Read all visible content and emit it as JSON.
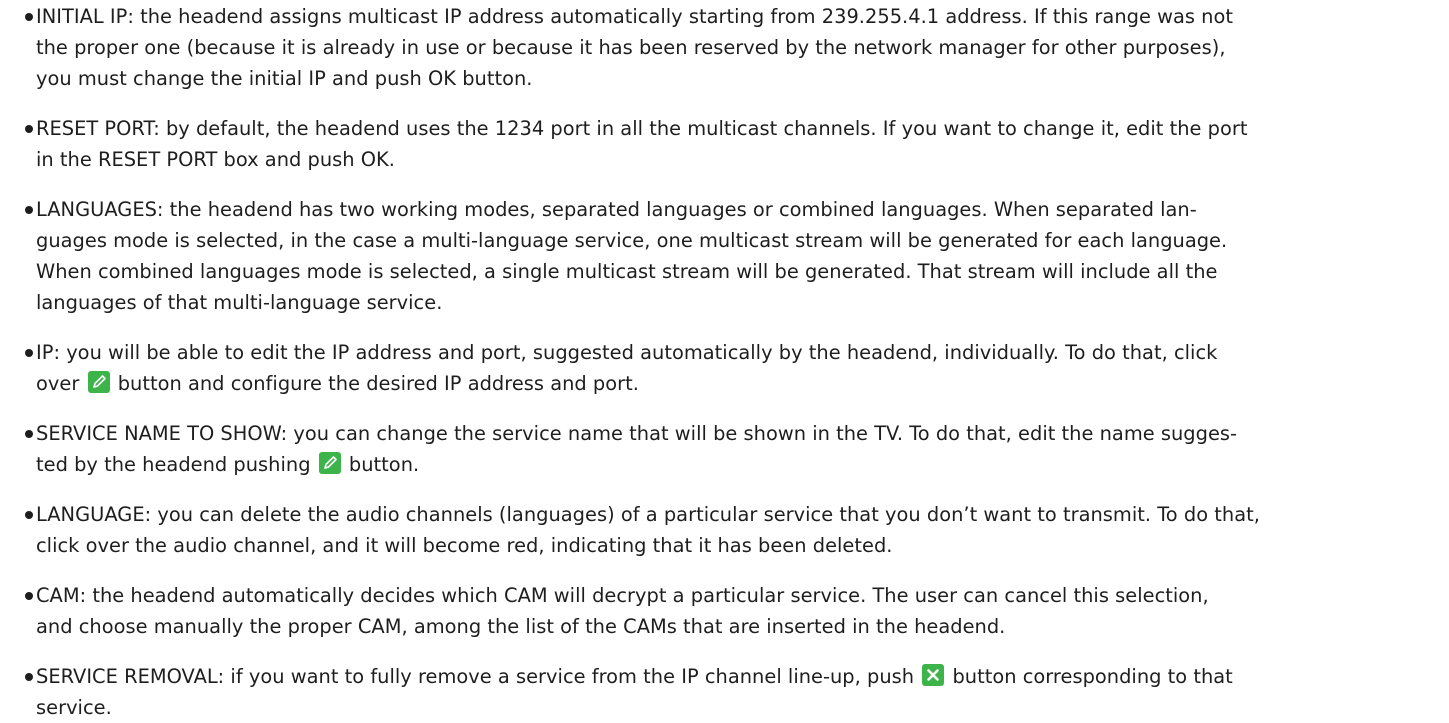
{
  "items": [
    {
      "lines": [
        "INITIAL IP: the headend assigns multicast IP address automatically starting from 239.255.4.1 address. If this range was not",
        "the proper one (because it is already in use or because it has been reserved by the network manager for other purposes),",
        "you must change the initial IP and push OK button."
      ]
    },
    {
      "lines": [
        "RESET PORT: by default, the headend uses the 1234 port in all the multicast channels. If you want to change it, edit the port",
        "in the RESET PORT box and push OK."
      ]
    },
    {
      "lines": [
        "LANGUAGES: the headend has two working modes, separated languages or combined languages. When separated lan-",
        "guages mode is selected, in the case a multi-language service, one multicast stream will be generated for each language.",
        "When combined languages mode is selected, a single multicast stream will be generated. That stream will include all the",
        "languages of that multi-language service."
      ]
    },
    {
      "lines": [
        "IP: you will be able to edit the IP address and port, suggested automatically by the headend, individually. To do that, click"
      ],
      "line2_before": "over",
      "line2_after": "button and configure the desired IP address and port."
    },
    {
      "lines": [
        "SERVICE NAME TO SHOW: you can change the service name that will be shown in the TV. To do that, edit the name sugges-"
      ],
      "line2_before": "ted by the headend pushing",
      "line2_after": "button."
    },
    {
      "lines": [
        "LANGUAGE: you can delete the audio channels (languages) of a particular service that you don’t want to transmit. To do that,",
        "click over the audio channel, and it will become red, indicating that it has been deleted."
      ]
    },
    {
      "lines": [
        "CAM: the headend automatically decides which CAM will decrypt a particular service. The user can cancel this selection,",
        "and choose manually the proper CAM, among the list of the CAMs that are inserted in the headend."
      ]
    },
    {
      "line1_before": "SERVICE REMOVAL: if you want to fully remove a service from the IP channel line-up, push",
      "line1_after": "button corresponding to that",
      "lines_rest": [
        "service."
      ]
    }
  ],
  "icons": {
    "edit": "edit-icon",
    "remove": "remove-icon",
    "accent_green": "#3cb44a",
    "accent_white": "#ffffff"
  }
}
